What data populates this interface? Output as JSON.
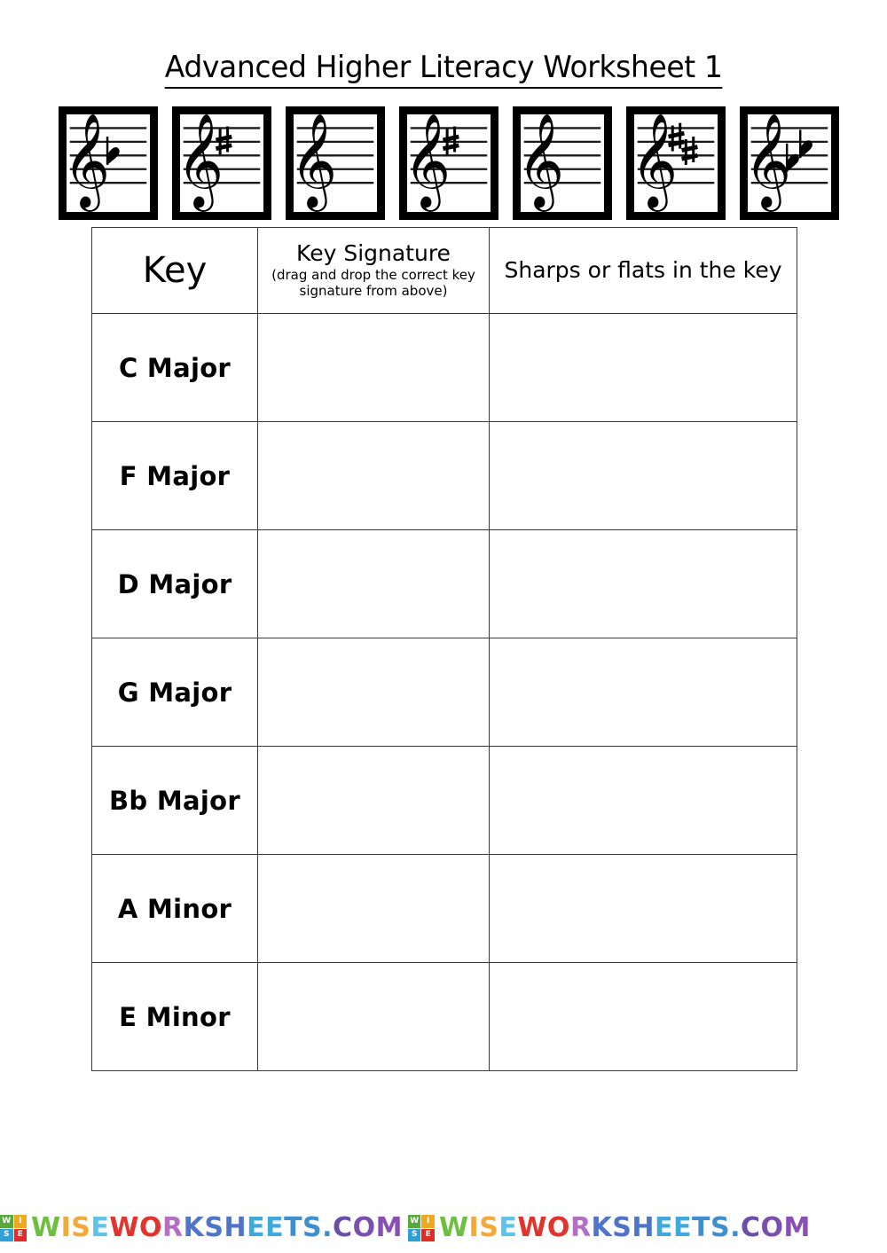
{
  "page": {
    "title": "Advanced Higher Literacy Worksheet 1"
  },
  "key_signature_cards": [
    {
      "name": "key-signature-card-1-flat",
      "accidental": "flat",
      "count": 1,
      "alt": "Treble clef with one flat"
    },
    {
      "name": "key-signature-card-1-sharp",
      "accidental": "sharp",
      "count": 1,
      "alt": "Treble clef with one sharp"
    },
    {
      "name": "key-signature-card-none-a",
      "accidental": "none",
      "count": 0,
      "alt": "Treble clef with no sharps or flats"
    },
    {
      "name": "key-signature-card-1-sharp-b",
      "accidental": "sharp",
      "count": 1,
      "alt": "Treble clef with one sharp"
    },
    {
      "name": "key-signature-card-none-b",
      "accidental": "none",
      "count": 0,
      "alt": "Treble clef with no sharps or flats"
    },
    {
      "name": "key-signature-card-2-sharps",
      "accidental": "sharp",
      "count": 2,
      "alt": "Treble clef with two sharps"
    },
    {
      "name": "key-signature-card-2-flats",
      "accidental": "flat",
      "count": 2,
      "alt": "Treble clef with two flats"
    }
  ],
  "table": {
    "headers": {
      "key": "Key",
      "key_signature_main": "Key Signature",
      "key_signature_sub": "(drag and drop the correct key signature from above)",
      "sharps_or_flats": "Sharps or flats in the key"
    },
    "rows": [
      {
        "key": "C Major",
        "key_signature": "",
        "sharps_or_flats": ""
      },
      {
        "key": "F Major",
        "key_signature": "",
        "sharps_or_flats": ""
      },
      {
        "key": "D Major",
        "key_signature": "",
        "sharps_or_flats": ""
      },
      {
        "key": "G Major",
        "key_signature": "",
        "sharps_or_flats": ""
      },
      {
        "key": "Bb Major",
        "key_signature": "",
        "sharps_or_flats": ""
      },
      {
        "key": "A Minor",
        "key_signature": "",
        "sharps_or_flats": ""
      },
      {
        "key": "E Minor",
        "key_signature": "",
        "sharps_or_flats": ""
      }
    ]
  },
  "footer": {
    "badge_letters": [
      "W",
      "I",
      "S",
      "E"
    ],
    "badge_colors": [
      "#57a93b",
      "#f0a81e",
      "#2f9fd6",
      "#e02b26"
    ],
    "wordmark": "WISEWORKSHEETS.COM",
    "letter_colors": [
      "#6cbf3f",
      "#f2a93a",
      "#f2a93a",
      "#5fc2e8",
      "#e0342c",
      "#e0342c",
      "#b46fc4",
      "#4f74c8",
      "#4f74c8",
      "#4f74c8",
      "#3fa9dd",
      "#3fa9dd",
      "#3f8fd0",
      "#3f8fd0",
      "#3f8fd0",
      "#6a4fa8",
      "#7a4fae",
      "#8a4fb4"
    ],
    "repeat_count": 2
  }
}
